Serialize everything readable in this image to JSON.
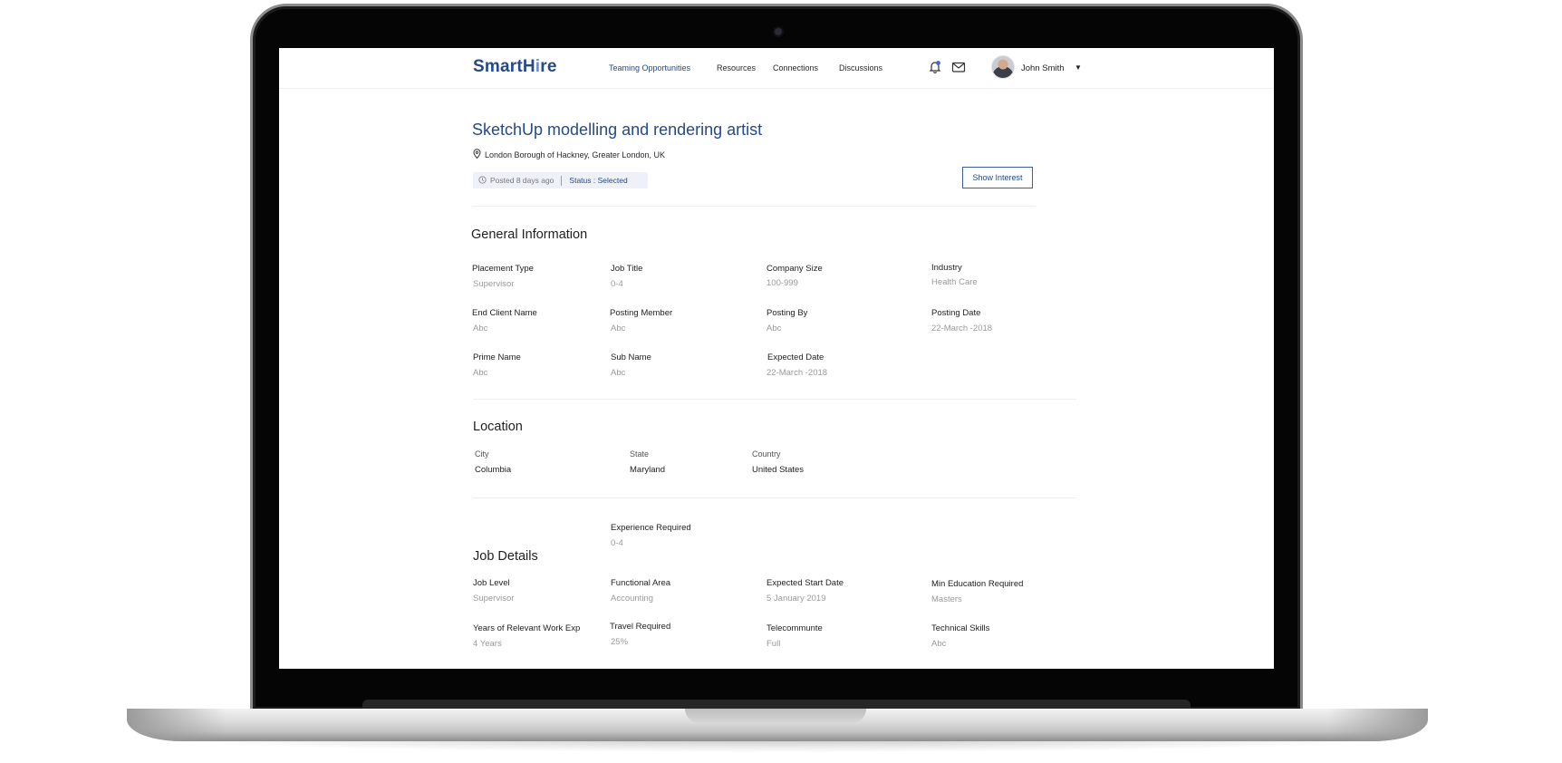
{
  "header": {
    "logo_text": "SmartH",
    "logo_mark": "i",
    "logo_suffix": "re",
    "nav": [
      "Teaming Opportunities",
      "Resources",
      "Connections",
      "Discussions"
    ],
    "active_nav": "Teaming Opportunities",
    "user_name": "John Smith",
    "icons": [
      "bell-icon",
      "mail-icon",
      "chevron-down-icon"
    ]
  },
  "job": {
    "title": "SketchUp modelling and rendering artist",
    "location": "London Borough of Hackney, Greater London, UK",
    "posted": "Posted 8 days ago",
    "status": "Status : Selected",
    "show_interest": "Show Interest"
  },
  "general": {
    "title": "General Information",
    "fields": [
      {
        "label": "Placement Type",
        "value": "Supervisor"
      },
      {
        "label": "Job Title",
        "value": "0-4"
      },
      {
        "label": "Company Size",
        "value": "100-999"
      },
      {
        "label": "Industry",
        "value": "Health Care"
      },
      {
        "label": "End Client Name",
        "value": "Abc"
      },
      {
        "label": "Posting Member",
        "value": "Abc"
      },
      {
        "label": "Posting By",
        "value": "Abc"
      },
      {
        "label": "Posting Date",
        "value": "22-March -2018"
      },
      {
        "label": "Prime Name",
        "value": "Abc"
      },
      {
        "label": "Sub Name",
        "value": "Abc"
      },
      {
        "label": "Expected Date",
        "value": "22-March -2018"
      }
    ]
  },
  "location": {
    "title": "Location",
    "fields": [
      {
        "label": "City",
        "value": "Columbia"
      },
      {
        "label": "State",
        "value": "Maryland"
      },
      {
        "label": "Country",
        "value": "United States"
      }
    ]
  },
  "job_details": {
    "title": "Job Details",
    "experience": {
      "label": "Experience Required",
      "value": "0-4"
    },
    "fields": [
      {
        "label": "Job Level",
        "value": "Supervisor"
      },
      {
        "label": "Functional Area",
        "value": "Accounting"
      },
      {
        "label": "Expected Start Date",
        "value": "5 January 2019"
      },
      {
        "label": "Min Education Required",
        "value": "Masters"
      },
      {
        "label": "Years of Relevant Work Exp",
        "value": "4 Years"
      },
      {
        "label": "Travel Required",
        "value": "25%"
      },
      {
        "label": "Telecommunte",
        "value": "Full"
      },
      {
        "label": "Technical Skills",
        "value": "Abc"
      }
    ]
  },
  "colors": {
    "brand": "#254a8a",
    "muted": "#9a9a9a",
    "bezel": "#050505"
  }
}
